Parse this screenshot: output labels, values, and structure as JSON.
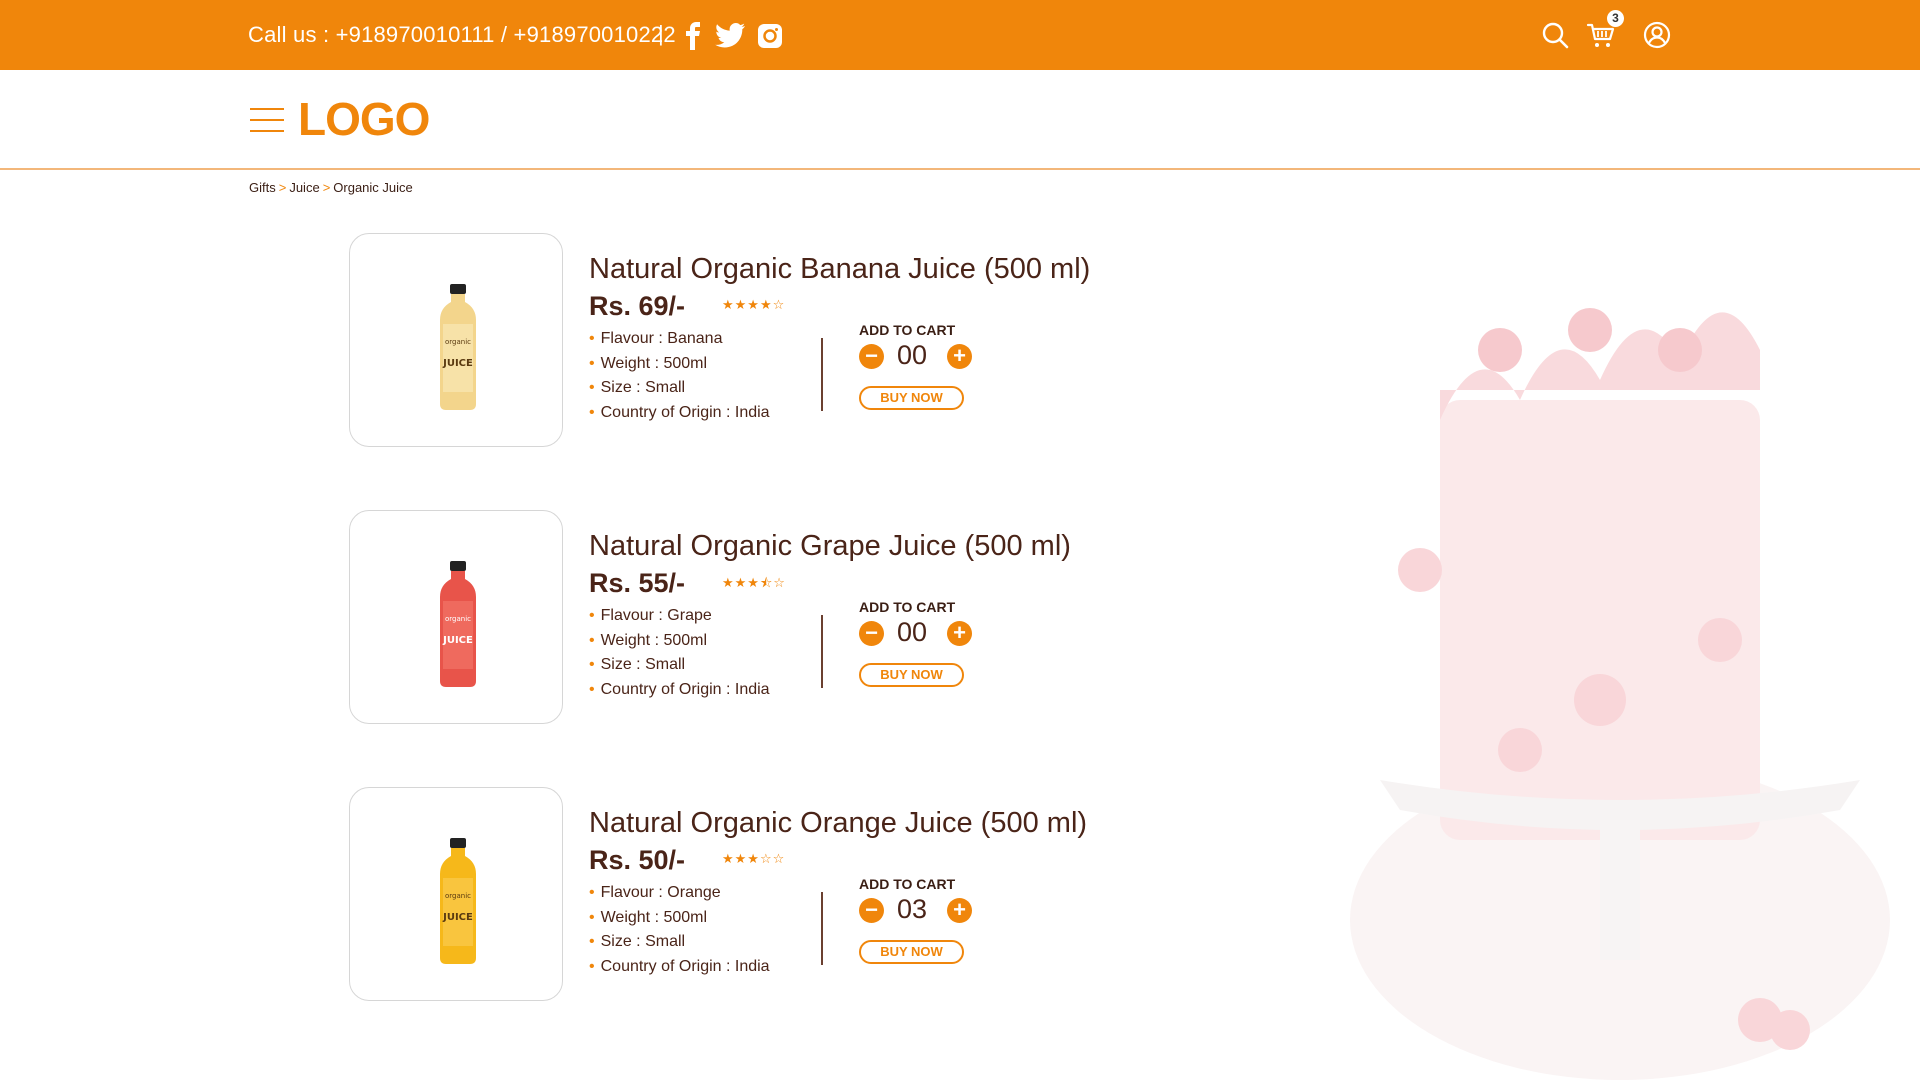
{
  "header": {
    "call_text": "Call us : +918970010111 / +918970010222",
    "separator": "|",
    "cart_count": "3",
    "accent": "#f0860b"
  },
  "nav": {
    "logo": "LOGO"
  },
  "breadcrumb": {
    "items": [
      "Gifts",
      "Juice",
      "Organic Juice"
    ],
    "sep": ">"
  },
  "products": [
    {
      "name": "Natural Organic Banana Juice (500 ml)",
      "price": "Rs. 69/-",
      "rating_stars": "★★★★☆",
      "specs": [
        "Flavour : Banana",
        "Weight : 500ml",
        "Size : Small",
        "Country of Origin : India"
      ],
      "add_to_cart": "ADD TO CART",
      "qty": "00",
      "buy_now": "BUY NOW",
      "bottle_color": "#f3d58c"
    },
    {
      "name": "Natural Organic Grape Juice (500 ml)",
      "price": "Rs. 55/-",
      "rating_stars": "★★★⯪☆",
      "specs": [
        "Flavour : Grape",
        "Weight : 500ml",
        "Size : Small",
        "Country of Origin : India"
      ],
      "add_to_cart": "ADD TO CART",
      "qty": "00",
      "buy_now": "BUY NOW",
      "bottle_color": "#e8544a"
    },
    {
      "name": "Natural Organic Orange Juice (500 ml)",
      "price": "Rs. 50/-",
      "rating_stars": "★★★☆☆",
      "specs": [
        "Flavour : Orange",
        "Weight : 500ml",
        "Size : Small",
        "Country of Origin : India"
      ],
      "add_to_cart": "ADD TO CART",
      "qty": "03",
      "buy_now": "BUY NOW",
      "bottle_color": "#f6b81a"
    }
  ],
  "icons": {
    "social": [
      "facebook-icon",
      "twitter-icon",
      "instagram-icon"
    ],
    "header": [
      "search-icon",
      "cart-icon",
      "user-icon"
    ]
  }
}
